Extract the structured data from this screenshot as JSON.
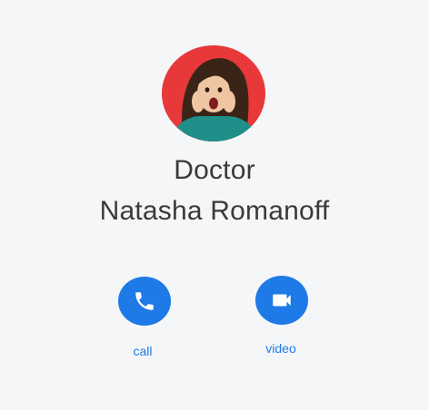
{
  "contact": {
    "title": "Doctor",
    "name": "Natasha Romanoff"
  },
  "actions": {
    "call_label": "call",
    "video_label": "video"
  },
  "colors": {
    "background": "#f5f6f8",
    "accent": "#1e7ae6",
    "text": "#3a3a3a",
    "avatar_background": "#e8383a",
    "avatar_sweater": "#1f8f8a"
  },
  "icons": {
    "call": "phone-icon",
    "video": "video-camera-icon"
  }
}
